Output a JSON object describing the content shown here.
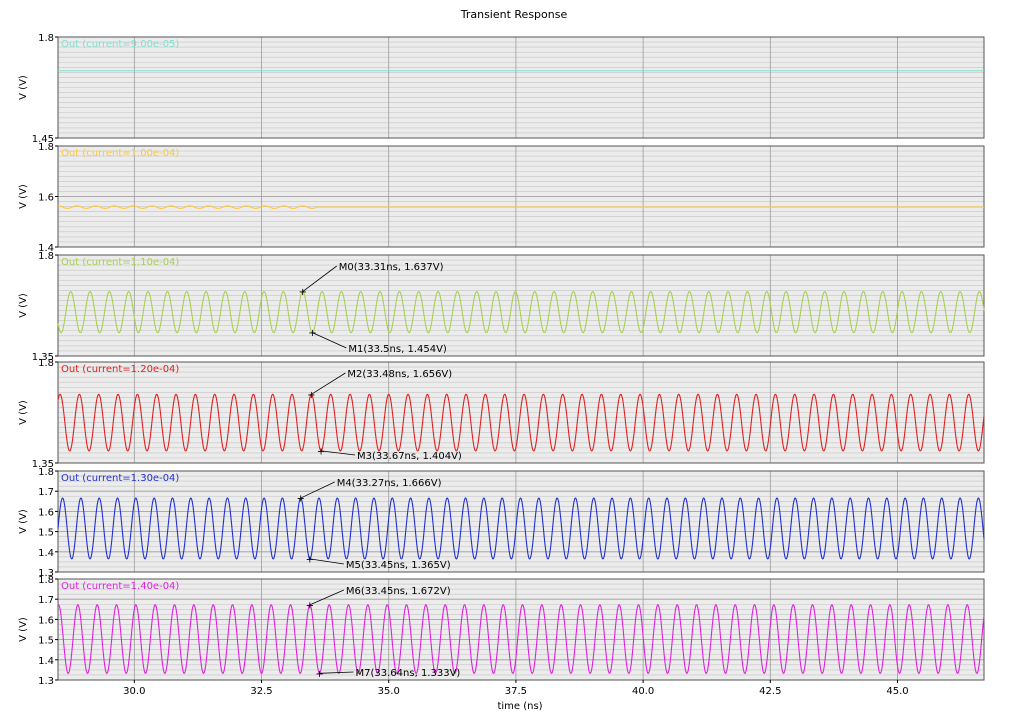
{
  "title": "Transient Response",
  "xlabel": "time (ns)",
  "chart_data": {
    "type": "line",
    "title": "Transient Response",
    "xlabel": "time (ns)",
    "xlim": [
      28.5,
      46.7
    ],
    "xticks": [
      "30.0",
      "32.5",
      "35.0",
      "37.5",
      "40.0",
      "42.5",
      "45.0"
    ],
    "xtick_values": [
      30.0,
      32.5,
      35.0,
      37.5,
      40.0,
      42.5,
      45.0
    ],
    "grid": true,
    "panels": [
      {
        "name": "Out (current=9.00e-05)",
        "color": "#7fe0d0",
        "ylabel": "V (V)",
        "ylim": [
          1.45,
          1.8
        ],
        "yticks": [
          "1.8",
          "1.45"
        ],
        "ytick_values": [
          1.8,
          1.45
        ],
        "signal": {
          "kind": "flat",
          "level": 1.683
        },
        "markers": []
      },
      {
        "name": "Out (current=1.00e-04)",
        "color": "#ffc832",
        "ylabel": "V (V)",
        "ylim": [
          1.4,
          1.8
        ],
        "yticks": [
          "1.8",
          "1.6",
          "1.4"
        ],
        "ytick_values": [
          1.8,
          1.6,
          1.4
        ],
        "signal": {
          "kind": "damped",
          "level": 1.558,
          "ripple_amp": 0.005,
          "ripple_end": 33.6,
          "period": 0.37
        },
        "markers": []
      },
      {
        "name": "Out (current=1.10e-04)",
        "color": "#a8d050",
        "ylabel": "V (V)",
        "ylim": [
          1.35,
          1.8
        ],
        "yticks": [
          "1.8",
          "1.35"
        ],
        "ytick_values": [
          1.8,
          1.35
        ],
        "signal": {
          "kind": "sine",
          "high": 1.637,
          "low": 1.454,
          "period": 0.38,
          "peak_t": 33.31
        },
        "markers": [
          {
            "label": "M0(33.31ns, 1.637V)",
            "t": 33.31,
            "v": 1.637
          },
          {
            "label": "M1(33.5ns, 1.454V)",
            "t": 33.5,
            "v": 1.454
          }
        ]
      },
      {
        "name": "Out (current=1.20e-04)",
        "color": "#e02020",
        "ylabel": "V (V)",
        "ylim": [
          1.35,
          1.8
        ],
        "yticks": [
          "1.8",
          "1.35"
        ],
        "ytick_values": [
          1.8,
          1.35
        ],
        "signal": {
          "kind": "sine",
          "high": 1.656,
          "low": 1.404,
          "period": 0.38,
          "peak_t": 33.48
        },
        "markers": [
          {
            "label": "M2(33.48ns, 1.656V)",
            "t": 33.48,
            "v": 1.656
          },
          {
            "label": "M3(33.67ns, 1.404V)",
            "t": 33.67,
            "v": 1.404
          }
        ]
      },
      {
        "name": "Out (current=1.30e-04)",
        "color": "#2030d0",
        "ylabel": "V (V)",
        "ylim": [
          1.3,
          1.8
        ],
        "yticks": [
          "1.8",
          "1.7",
          "1.6",
          "1.5",
          "1.4",
          "1.3"
        ],
        "ytick_values": [
          1.8,
          1.7,
          1.6,
          1.5,
          1.4,
          1.3
        ],
        "signal": {
          "kind": "sine",
          "high": 1.666,
          "low": 1.365,
          "period": 0.36,
          "peak_t": 33.27
        },
        "markers": [
          {
            "label": "M4(33.27ns, 1.666V)",
            "t": 33.27,
            "v": 1.666
          },
          {
            "label": "M5(33.45ns, 1.365V)",
            "t": 33.45,
            "v": 1.365
          }
        ]
      },
      {
        "name": "Out (current=1.40e-04)",
        "color": "#e020e0",
        "ylabel": "V (V)",
        "ylim": [
          1.3,
          1.8
        ],
        "yticks": [
          "1.8",
          "1.7",
          "1.6",
          "1.5",
          "1.4",
          "1.3"
        ],
        "ytick_values": [
          1.8,
          1.7,
          1.6,
          1.5,
          1.4,
          1.3
        ],
        "signal": {
          "kind": "sine",
          "high": 1.672,
          "low": 1.333,
          "period": 0.38,
          "peak_t": 33.45
        },
        "markers": [
          {
            "label": "M6(33.45ns, 1.672V)",
            "t": 33.45,
            "v": 1.672
          },
          {
            "label": "M7(33.64ns, 1.333V)",
            "t": 33.64,
            "v": 1.333
          }
        ]
      }
    ]
  }
}
